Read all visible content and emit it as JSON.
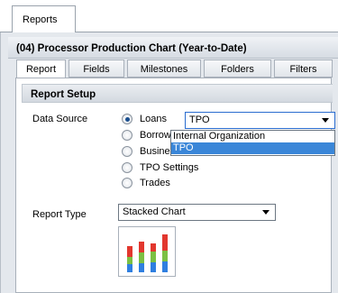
{
  "outer_tab": {
    "label": "Reports"
  },
  "panel": {
    "title": "(04) Processor Production Chart (Year-to-Date)"
  },
  "tabs": [
    {
      "label": "Report",
      "active": true
    },
    {
      "label": "Fields",
      "active": false
    },
    {
      "label": "Milestones",
      "active": false
    },
    {
      "label": "Folders",
      "active": false
    },
    {
      "label": "Filters",
      "active": false
    }
  ],
  "report_setup": {
    "header": "Report Setup",
    "data_source_label": "Data Source",
    "options": [
      {
        "label": "Loans",
        "selected": true
      },
      {
        "label": "Borrowe",
        "selected": false
      },
      {
        "label": "Business",
        "selected": false
      },
      {
        "label": "TPO Settings",
        "selected": false
      },
      {
        "label": "Trades",
        "selected": false
      }
    ],
    "source_select_value": "TPO",
    "source_dropdown_options": [
      {
        "label": "Internal Organization",
        "highlighted": false
      },
      {
        "label": "TPO",
        "highlighted": true
      }
    ],
    "report_type_label": "Report Type",
    "report_type_value": "Stacked Chart",
    "chart_icon": "stacked-chart-icon"
  },
  "colors": {
    "bar_blue": "#2f7fe0",
    "bar_green": "#7bc043",
    "bar_red": "#e2372e",
    "dropdown_highlight": "#3a86d8"
  }
}
